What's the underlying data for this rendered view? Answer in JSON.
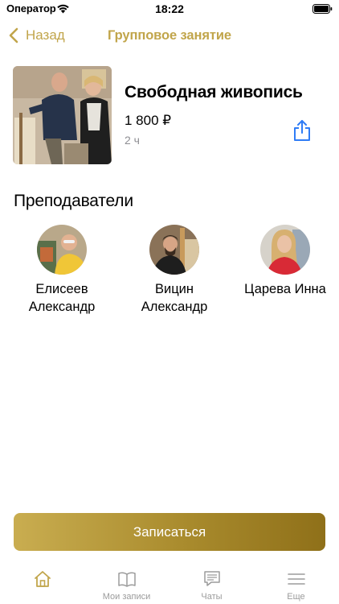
{
  "status_bar": {
    "carrier": "Оператор",
    "time": "18:22"
  },
  "nav": {
    "back_label": "Назад",
    "title": "Групповое занятие"
  },
  "course": {
    "title": "Свободная живопись",
    "price": "1 800 ₽",
    "duration": "2 ч"
  },
  "teachers_section": {
    "title": "Преподаватели",
    "teachers": [
      {
        "name_line1": "Елисеев",
        "name_line2": "Александр"
      },
      {
        "name_line1": "Вицин",
        "name_line2": "Александр"
      },
      {
        "name_line1": "Царева Инна",
        "name_line2": ""
      }
    ]
  },
  "actions": {
    "signup_label": "Записаться"
  },
  "tab_bar": {
    "items": [
      {
        "icon": "home-icon",
        "label": "",
        "active": true
      },
      {
        "icon": "book-icon",
        "label": "Мои записи",
        "active": false
      },
      {
        "icon": "chat-icon",
        "label": "Чаты",
        "active": false
      },
      {
        "icon": "menu-icon",
        "label": "Еще",
        "active": false
      }
    ]
  },
  "colors": {
    "accent": "#c1a54b",
    "share_blue": "#2f7cf6",
    "secondary_text": "#8e8e93",
    "tab_inactive": "#9b9b9b"
  }
}
